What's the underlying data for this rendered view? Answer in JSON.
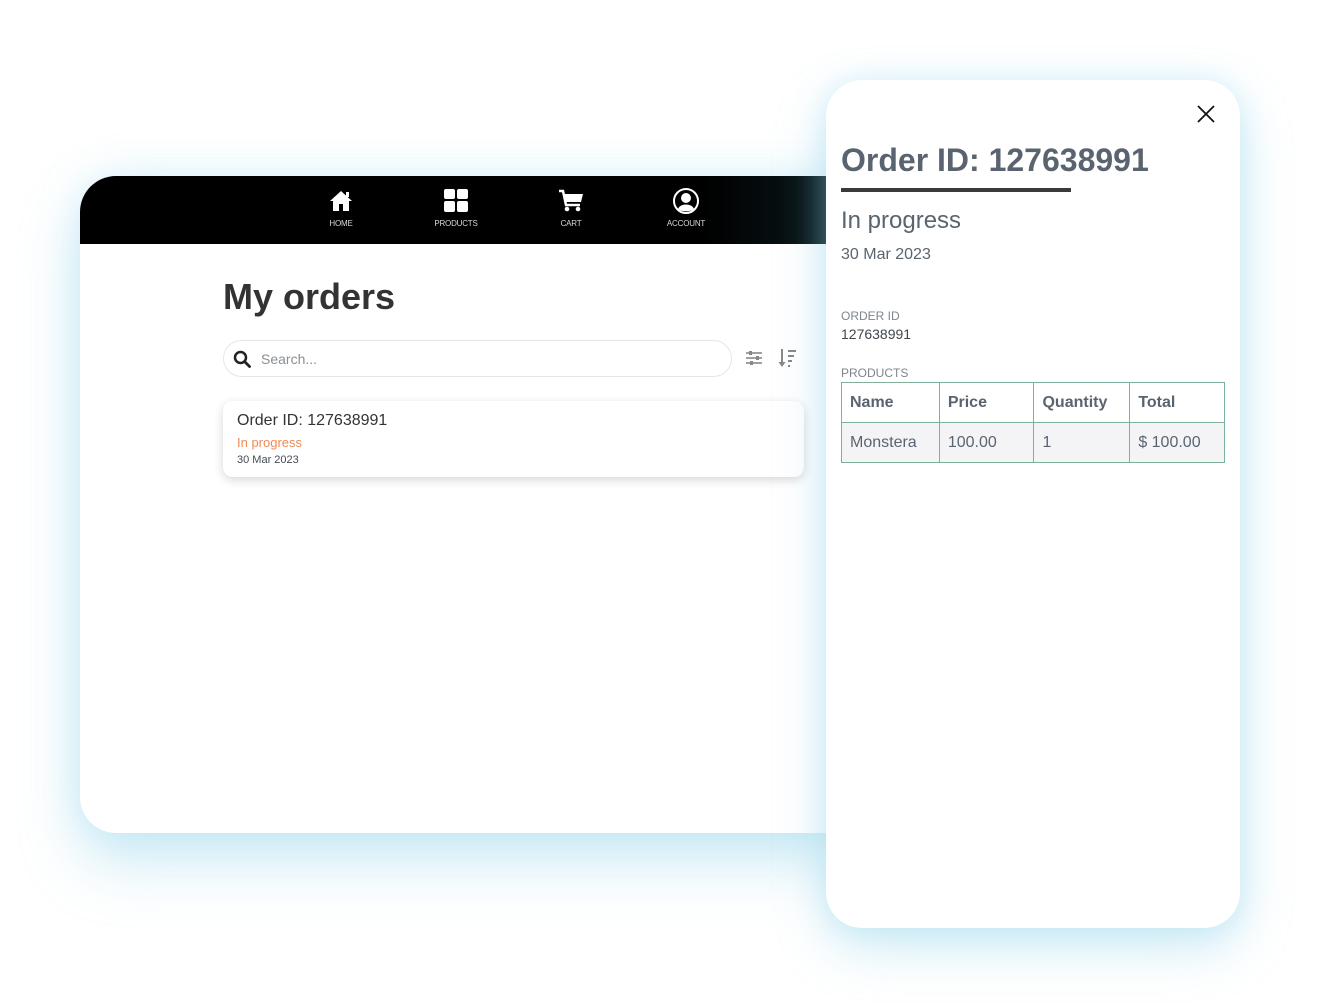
{
  "nav": {
    "items": [
      {
        "label": "HOME",
        "icon": "home-icon"
      },
      {
        "label": "PRODUCTS",
        "icon": "grid-icon"
      },
      {
        "label": "CART",
        "icon": "cart-icon"
      },
      {
        "label": "ACCOUNT",
        "icon": "account-icon"
      }
    ]
  },
  "orders_page": {
    "title": "My orders",
    "search": {
      "placeholder": "Search...",
      "value": ""
    },
    "filter_icon": "sliders-icon",
    "sort_icon": "sort-descending-icon",
    "orders": [
      {
        "order_id_label": "Order ID: 127638991",
        "status": "In progress",
        "date": "30 Mar 2023"
      }
    ]
  },
  "detail": {
    "title": "Order ID: 127638991",
    "status": "In progress",
    "date": "30 Mar 2023",
    "order_id_label": "ORDER ID",
    "order_id_value": "127638991",
    "products_label": "PRODUCTS",
    "table": {
      "headers": [
        "Name",
        "Price",
        "Quantity",
        "Total"
      ],
      "rows": [
        [
          "Monstera",
          "100.00",
          "1",
          "$ 100.00"
        ]
      ]
    }
  },
  "colors": {
    "status_accent": "#ef8a55",
    "table_border": "#7fb19a",
    "nav_bg": "#000000",
    "heading_text": "#5a6470"
  }
}
